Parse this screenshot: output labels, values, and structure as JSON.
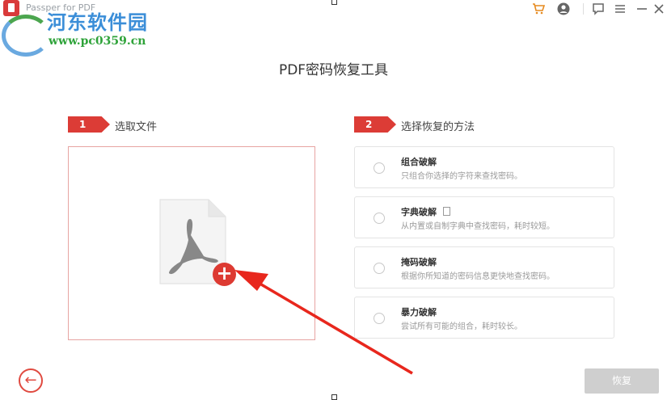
{
  "titlebar": {
    "app_title": "Passper for PDF",
    "icons": [
      "cart-icon",
      "user-icon",
      "feedback-icon",
      "menu-icon",
      "minimize-icon",
      "close-icon"
    ]
  },
  "watermark": {
    "site_name": "河东软件园",
    "url": "www.pc0359.cn"
  },
  "main": {
    "title": "PDF密码恢复工具",
    "step1": {
      "number": "1",
      "label": "选取文件"
    },
    "step2": {
      "number": "2",
      "label": "选择恢复的方法"
    },
    "add_button": "+"
  },
  "methods": [
    {
      "title": "组合破解",
      "desc": "只组合你选择的字符来查找密码。"
    },
    {
      "title": "字典破解",
      "desc": "从内置或自制字典中查找密码，耗时较短。"
    },
    {
      "title": "掩码破解",
      "desc": "根据你所知道的密码信息更快地查找密码。"
    },
    {
      "title": "暴力破解",
      "desc": "尝试所有可能的组合，耗时较长。"
    }
  ],
  "footer": {
    "back_symbol": "←",
    "recover_label": "恢复"
  },
  "colors": {
    "accent": "#dc3c36",
    "disabled": "#cfcfcf"
  }
}
